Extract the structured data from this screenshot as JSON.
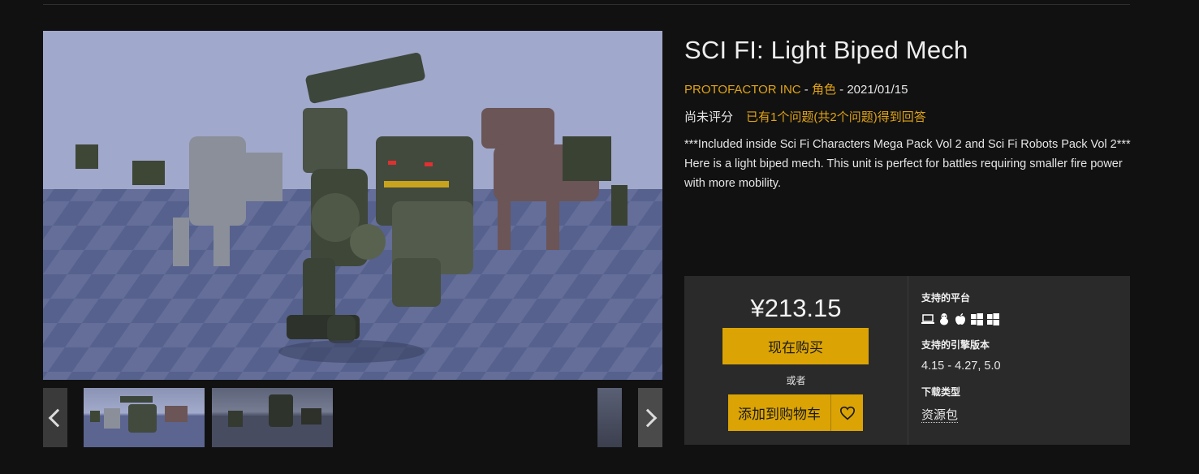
{
  "product": {
    "title": "SCI FI: Light Biped Mech",
    "seller": "PROTOFACTOR INC",
    "separator1": " - ",
    "category": "角色",
    "separator2": " - ",
    "date": "2021/01/15",
    "rating_text": "尚未评分",
    "qa_text": "已有1个问题(共2个问题)得到回答",
    "description": "***Included inside Sci Fi Characters Mega Pack Vol 2 and Sci Fi Robots Pack Vol 2*** Here is a light biped mech. This unit is perfect for battles requiring smaller fire power with more mobility."
  },
  "purchase": {
    "price": "¥213.15",
    "buy_label": "现在购买",
    "or_label": "或者",
    "cart_label": "添加到购物车"
  },
  "specs": {
    "platforms_label": "支持的平台",
    "platform_icons": [
      "laptop-icon",
      "linux-icon",
      "apple-icon",
      "windows-icon",
      "windows-icon"
    ],
    "engine_label": "支持的引擎版本",
    "engine_value": "4.15 - 4.27, 5.0",
    "download_label": "下载类型",
    "download_value": "资源包"
  },
  "colors": {
    "accent": "#dba404",
    "link": "#e0a316",
    "background": "#111111",
    "panel": "#2a2a2a"
  }
}
